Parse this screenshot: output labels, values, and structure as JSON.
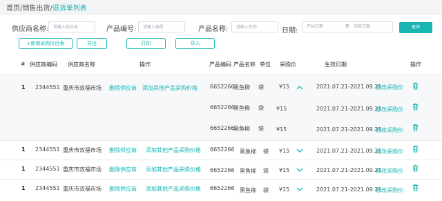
{
  "breadcrumb": {
    "part1": "首页/销售出货/",
    "current": "退货单列表"
  },
  "filters": {
    "supplier_label": "供应商名称:",
    "supplier_placeholder": "请输入供应商",
    "code_label": "产品编号:",
    "code_placeholder": "请输入编号",
    "pname_label": "产品名称:",
    "pname_placeholder": "请输入名称",
    "date_label": "日期:",
    "date_start": "开始日期",
    "date_sep": "至",
    "date_end": "结束日期",
    "query": "查询"
  },
  "toolbar": {
    "add": "+新增采购价目表",
    "export": "导出",
    "print": "打印",
    "import": "导入"
  },
  "headers": {
    "idx": "#",
    "supcode": "供应商编码",
    "supname": "供应商名称",
    "ops": "操作",
    "pcode": "产品编码",
    "pname": "产品名称",
    "unit": "单位",
    "price": "采购价",
    "date": "生效日期",
    "actions": "操作"
  },
  "links": {
    "del_supplier": "删除供应商",
    "add_price": "添加其他产品采购价格",
    "edit_price": "修改采购价"
  },
  "rows": [
    {
      "idx": "1",
      "supcode": "2344551",
      "supname": "重庆市双福市场",
      "pcode": "6652266",
      "pname": "黑鱼柳",
      "unit": "袋",
      "price": "¥15",
      "date": "2021.07.21-2021.09.21",
      "expander": "up"
    },
    {
      "pcode": "6652266",
      "pname": "黑鱼柳",
      "unit": "袋",
      "price": "¥15",
      "date": "2021.07.21-2021.09.21"
    },
    {
      "pcode": "6652266",
      "pname": "黑鱼柳",
      "unit": "袋",
      "price": "¥15",
      "date": "2021.07.21-2021.09.21"
    },
    {
      "idx": "1",
      "supcode": "2344551",
      "supname": "重庆市双福市场",
      "pcode": "6652266",
      "pname": "黑鱼柳",
      "unit": "袋",
      "price": "¥15",
      "date": "2021.07.21-2021.09.21",
      "expander": "down"
    },
    {
      "idx": "1",
      "supcode": "2344551",
      "supname": "重庆市双福市场",
      "pcode": "6652266",
      "pname": "黑鱼柳",
      "unit": "袋",
      "price": "¥15",
      "date": "2021.07.21-2021.09.21",
      "expander": "down"
    },
    {
      "idx": "1",
      "supcode": "2344551",
      "supname": "重庆市双福市场",
      "pcode": "6652266",
      "pname": "黑鱼柳",
      "unit": "袋",
      "price": "¥15",
      "date": "2021.07.21-2021.09.21",
      "expander": "down"
    }
  ],
  "colors": {
    "accent": "#18b5b3"
  }
}
